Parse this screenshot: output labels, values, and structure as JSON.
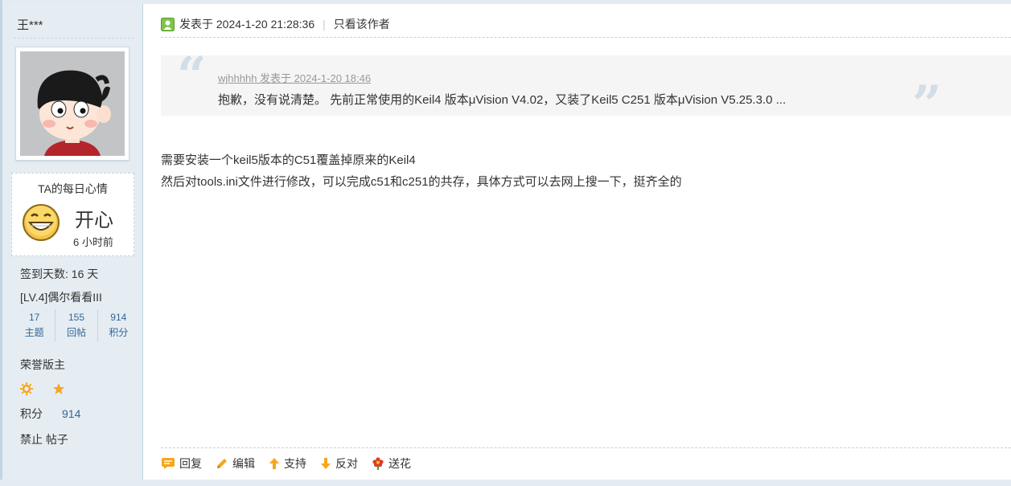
{
  "user": {
    "name": "王***",
    "mood": {
      "title": "TA的每日心情",
      "text": "开心",
      "time": "6 小时前"
    },
    "signin": "签到天数: 16 天",
    "level": "[LV.4]偶尔看看III",
    "stats": [
      {
        "value": "17",
        "label": "主题"
      },
      {
        "value": "155",
        "label": "回帖"
      },
      {
        "value": "914",
        "label": "积分"
      }
    ],
    "rank": "荣誉版主",
    "rank_icons": [
      "sun-icon",
      "moon-icon",
      "star-icon"
    ],
    "credits_label": "积分",
    "credits_value": "914",
    "ban": "禁止 帖子"
  },
  "post": {
    "posted": "发表于 2024-1-20 21:28:36",
    "only_author": "只看该作者",
    "quote": {
      "meta": "wjhhhhh 发表于 2024-1-20 18:46",
      "text": "抱歉，没有说清楚。   先前正常使用的Keil4 版本μVision V4.02，又装了Keil5 C251 版本μVision V5.25.3.0 ..."
    },
    "content": [
      "需要安装一个keil5版本的C51覆盖掉原来的Keil4",
      "然后对tools.ini文件进行修改，可以完成c51和c251的共存，具体方式可以去网上搜一下，挺齐全的"
    ]
  },
  "actions": [
    {
      "label": "回复",
      "icon": "reply-icon"
    },
    {
      "label": "编辑",
      "icon": "pencil-icon"
    },
    {
      "label": "支持",
      "icon": "arrow-up-icon"
    },
    {
      "label": "反对",
      "icon": "arrow-down-icon"
    },
    {
      "label": "送花",
      "icon": "flower-icon"
    }
  ],
  "colors": {
    "sidebar_bg": "#e5edf2",
    "border": "#c2d5e3",
    "link_blue": "#336699",
    "accent_orange": "#f6a61f",
    "quote_bg": "#f5f5f5"
  }
}
